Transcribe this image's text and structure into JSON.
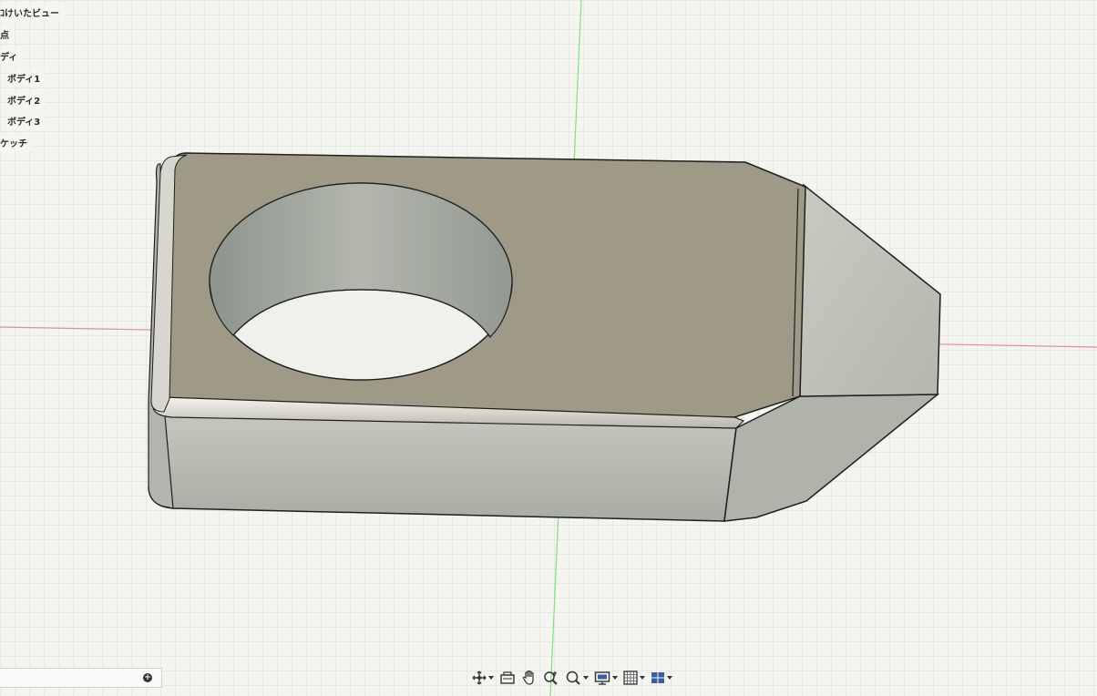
{
  "browser": {
    "items": [
      {
        "label": "ｺけいたビュー"
      },
      {
        "label": "点"
      },
      {
        "label": "ディ"
      },
      {
        "label": "ボディ1"
      },
      {
        "label": "ボディ2"
      },
      {
        "label": "ボディ3"
      },
      {
        "label": "ケッチ"
      }
    ]
  },
  "comments": {
    "add_icon": "plus-circle-icon",
    "add_glyph": "+"
  },
  "toolbar": {
    "buttons": [
      {
        "name": "orbit",
        "icon": "orbit-icon",
        "dropdown": true
      },
      {
        "name": "look-at",
        "icon": "look-at-icon",
        "dropdown": false
      },
      {
        "name": "pan",
        "icon": "pan-hand-icon",
        "dropdown": false
      },
      {
        "name": "zoom",
        "icon": "zoom-icon",
        "dropdown": false
      },
      {
        "name": "fit",
        "icon": "fit-zoom-icon",
        "dropdown": true
      },
      {
        "name": "display-settings",
        "icon": "display-settings-icon",
        "dropdown": true
      },
      {
        "name": "grid-snap",
        "icon": "grid-icon",
        "dropdown": true
      },
      {
        "name": "viewports",
        "icon": "viewports-icon",
        "dropdown": true
      }
    ]
  },
  "colors": {
    "background": "#f4f4f1",
    "grid_minor": "#dcdcd6",
    "grid_major": "#c8c8c1",
    "x_axis": "#e88a9a",
    "y_axis": "#7ee07e",
    "top_face": "#9f9a88",
    "side_face": "#b9bcb3",
    "end_face": "#c0c2ba",
    "edge": "#1e1e1e"
  }
}
